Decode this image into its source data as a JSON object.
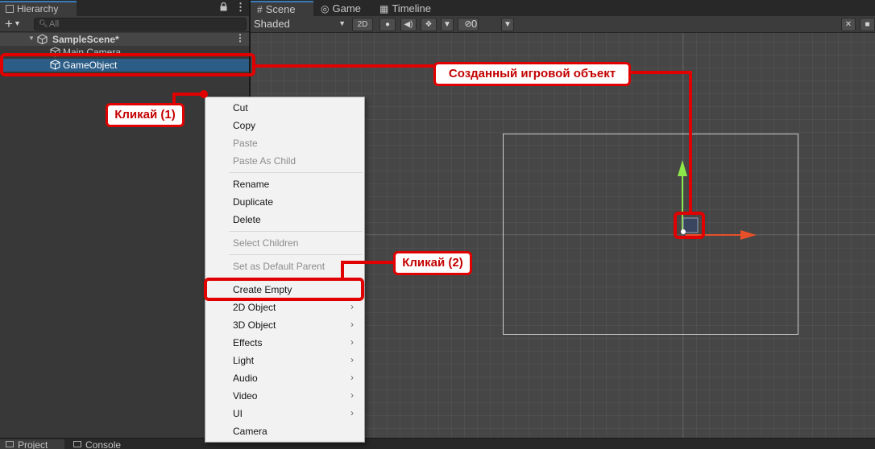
{
  "hierarchy": {
    "tab_title": "Hierarchy",
    "search_placeholder": "All",
    "scene_name": "SampleScene*",
    "items": [
      {
        "label": "Main Camera"
      },
      {
        "label": "GameObject"
      }
    ]
  },
  "scene_view": {
    "tabs": [
      {
        "label": "Scene"
      },
      {
        "label": "Game"
      },
      {
        "label": "Timeline"
      }
    ],
    "shading_mode": "Shaded",
    "mode_2d_label": "2D",
    "hidden_count": "0"
  },
  "bottom_tabs": [
    {
      "label": "Project"
    },
    {
      "label": "Console"
    }
  ],
  "context_menu": {
    "items": [
      {
        "label": "Cut",
        "enabled": true
      },
      {
        "label": "Copy",
        "enabled": true
      },
      {
        "label": "Paste",
        "enabled": false
      },
      {
        "label": "Paste As Child",
        "enabled": false
      },
      {
        "label": "Rename",
        "enabled": true
      },
      {
        "label": "Duplicate",
        "enabled": true
      },
      {
        "label": "Delete",
        "enabled": true
      },
      {
        "label": "Select Children",
        "enabled": false
      },
      {
        "label": "Set as Default Parent",
        "enabled": false
      },
      {
        "label": "Create Empty",
        "enabled": true
      },
      {
        "label": "2D Object",
        "enabled": true,
        "submenu": true
      },
      {
        "label": "3D Object",
        "enabled": true,
        "submenu": true
      },
      {
        "label": "Effects",
        "enabled": true,
        "submenu": true
      },
      {
        "label": "Light",
        "enabled": true,
        "submenu": true
      },
      {
        "label": "Audio",
        "enabled": true,
        "submenu": true
      },
      {
        "label": "Video",
        "enabled": true,
        "submenu": true
      },
      {
        "label": "UI",
        "enabled": true,
        "submenu": true
      },
      {
        "label": "Camera",
        "enabled": true
      }
    ]
  },
  "annotations": {
    "click1": "Кликай (1)",
    "click2": "Кликай (2)",
    "created": "Созданный игровой объект",
    "color": "#e00000"
  },
  "colors": {
    "selection": "#2c5d87",
    "tab_accent": "#3a79bb",
    "gizmo_y": "#8ee84a",
    "gizmo_x": "#e8502a"
  }
}
